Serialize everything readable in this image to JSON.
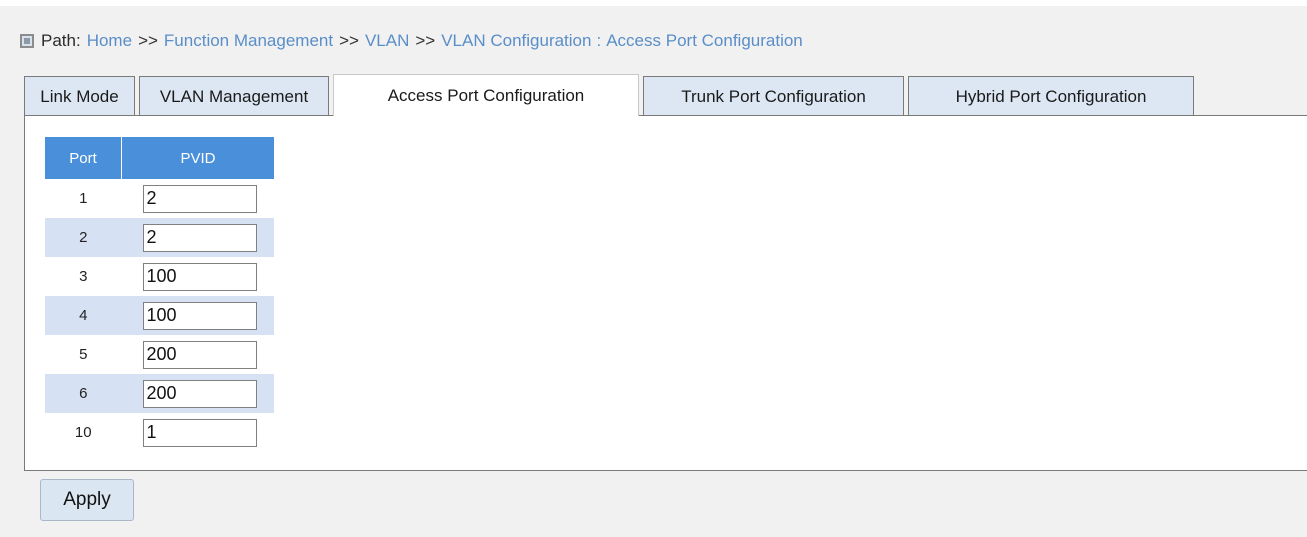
{
  "path": {
    "label": "Path:",
    "crumbs": [
      "Home",
      "Function Management",
      "VLAN",
      "VLAN Configuration"
    ],
    "separator": ">>",
    "colon": ":",
    "current": "Access Port Configuration"
  },
  "tabs": [
    {
      "label": "Link Mode",
      "active": false
    },
    {
      "label": "VLAN Management",
      "active": false
    },
    {
      "label": "Access Port Configuration",
      "active": true
    },
    {
      "label": "Trunk Port Configuration",
      "active": false
    },
    {
      "label": "Hybrid Port Configuration",
      "active": false
    }
  ],
  "table": {
    "headers": {
      "port": "Port",
      "pvid": "PVID"
    },
    "rows": [
      {
        "port": "1",
        "pvid": "2"
      },
      {
        "port": "2",
        "pvid": "2"
      },
      {
        "port": "3",
        "pvid": "100"
      },
      {
        "port": "4",
        "pvid": "100"
      },
      {
        "port": "5",
        "pvid": "200"
      },
      {
        "port": "6",
        "pvid": "200"
      },
      {
        "port": "10",
        "pvid": "1"
      }
    ]
  },
  "actions": {
    "apply_label": "Apply"
  },
  "colors": {
    "header_bg": "#4a8fda",
    "alt_row_bg": "#d6e2f4",
    "tab_bg": "#dde7f3",
    "link": "#5a8ec8"
  }
}
